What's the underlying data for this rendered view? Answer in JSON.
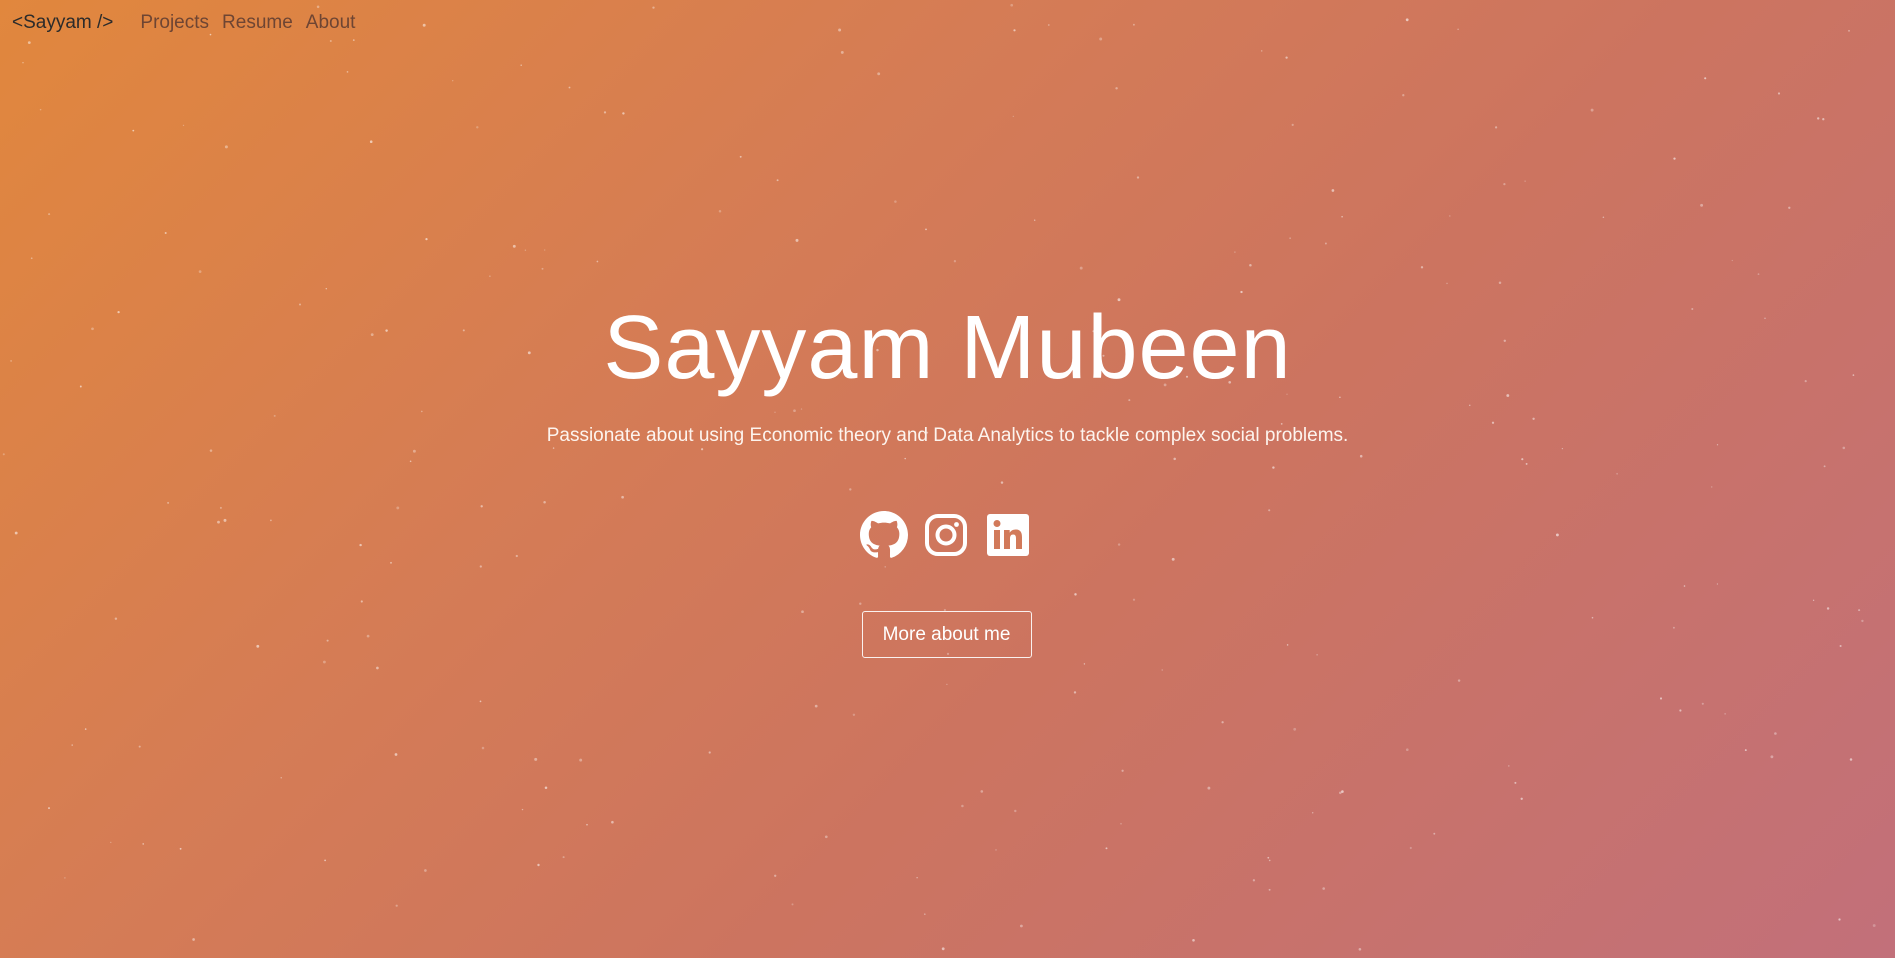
{
  "nav": {
    "brand": "<Sayyam />",
    "links": [
      {
        "label": "Projects"
      },
      {
        "label": "Resume"
      },
      {
        "label": "About"
      }
    ]
  },
  "hero": {
    "name": "Sayyam Mubeen",
    "tagline": "Passionate about using Economic theory and Data Analytics to tackle complex social problems.",
    "socials": [
      {
        "icon": "github-icon"
      },
      {
        "icon": "instagram-icon"
      },
      {
        "icon": "linkedin-icon"
      }
    ],
    "cta_label": "More about me"
  },
  "colors": {
    "gradient_start": "#e1873d",
    "gradient_end": "#c2707a",
    "text": "#ffffff",
    "brand": "#2b2b2b",
    "nav_link": "#6e4533"
  }
}
